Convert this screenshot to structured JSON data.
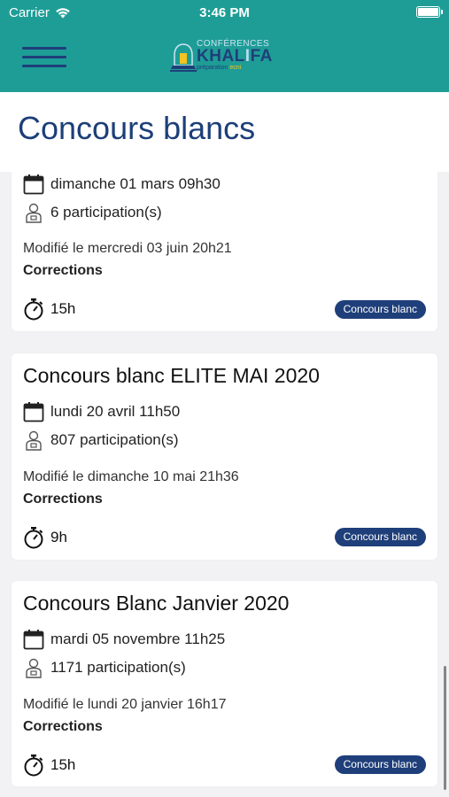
{
  "status": {
    "carrier": "Carrier",
    "time": "3:46 PM"
  },
  "header": {
    "logo": {
      "line1": "CONFÉRENCES",
      "brand_a": "KHAL",
      "brand_b": "I",
      "brand_c": "FA",
      "tag_a": "préparation ",
      "tag_b": "ecni"
    }
  },
  "page": {
    "title": "Concours blancs"
  },
  "cards": [
    {
      "title": "",
      "date": "dimanche 01 mars 09h30",
      "participations": "6 participation(s)",
      "modified": "Modifié le mercredi 03 juin 20h21",
      "corrections": "Corrections",
      "duration": "15h",
      "badge": "Concours blanc"
    },
    {
      "title": "Concours blanc ELITE MAI 2020",
      "date": "lundi 20 avril 11h50",
      "participations": "807 participation(s)",
      "modified": "Modifié le dimanche 10 mai 21h36",
      "corrections": "Corrections",
      "duration": "9h",
      "badge": "Concours blanc"
    },
    {
      "title": "Concours Blanc Janvier 2020",
      "date": "mardi 05 novembre 11h25",
      "participations": "1171 participation(s)",
      "modified": "Modifié le lundi 20 janvier 16h17",
      "corrections": "Corrections",
      "duration": "15h",
      "badge": "Concours blanc"
    }
  ],
  "icons": {
    "menu": "hamburger-icon",
    "date": "calendar-icon",
    "participants": "person-icon",
    "duration": "stopwatch-icon"
  },
  "colors": {
    "header": "#1e9d96",
    "accent": "#1f3f7a",
    "title": "#1c3f78"
  }
}
